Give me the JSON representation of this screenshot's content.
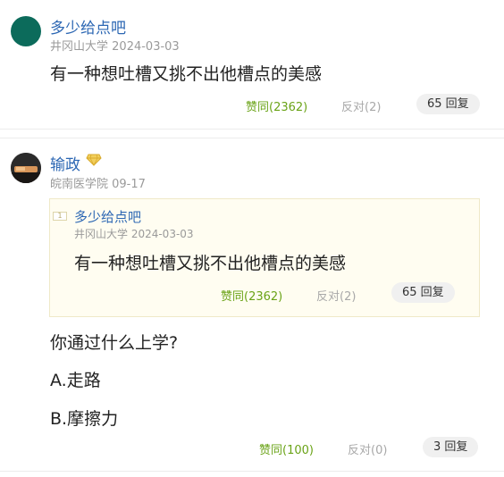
{
  "comments": [
    {
      "username": "多少给点吧",
      "school": "井冈山大学",
      "date": "2024-03-03",
      "text": "有一种想吐槽又挑不出他槽点的美感",
      "agree_label": "赞同(2362)",
      "oppose_label": "反对(2)",
      "reply_label": "65 回复",
      "avatar_color": "#0c6b5b"
    },
    {
      "username": "输政",
      "badge_icon": "diamond-vip-icon",
      "school_date": "皖南医学院 09-17",
      "quote": {
        "floor": "1",
        "username": "多少给点吧",
        "school_date": "井冈山大学 2024-03-03",
        "text": "有一种想吐槽又挑不出他槽点的美感",
        "agree_label": "赞同(2362)",
        "oppose_label": "反对(2)",
        "reply_label": "65 回复"
      },
      "question": "你通过什么上学?",
      "option_a": "A.走路",
      "option_b": "B.摩擦力",
      "agree_label": "赞同(100)",
      "oppose_label": "反对(0)",
      "reply_label": "3 回复"
    }
  ],
  "colors": {
    "username": "#2c67b3",
    "agree": "#6aa317",
    "oppose": "#a8a8a8",
    "quote_bg": "#fffdf1",
    "badge": "#e8c24a"
  }
}
